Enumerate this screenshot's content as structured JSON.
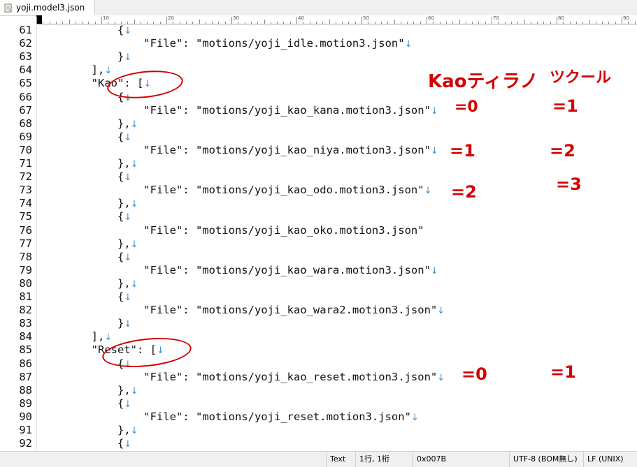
{
  "tab": {
    "title": "yoji.model3.json",
    "close_glyph": "⊠",
    "icon": "text-file-icon"
  },
  "ruler": {
    "labels": [
      "10",
      "20",
      "30",
      "40",
      "50",
      "60",
      "70",
      "80",
      "90"
    ]
  },
  "code_lines": [
    {
      "num": "61",
      "text": "            {",
      "eol": "↓"
    },
    {
      "num": "62",
      "text": "                \"File\": \"motions/yoji_idle.motion3.json\"",
      "eol": "↓"
    },
    {
      "num": "63",
      "text": "            }",
      "eol": "↓"
    },
    {
      "num": "64",
      "text": "        ],",
      "eol": "↓"
    },
    {
      "num": "65",
      "text": "        \"Kao\": [",
      "eol": "↓"
    },
    {
      "num": "66",
      "text": "            {",
      "eol": "↓"
    },
    {
      "num": "67",
      "text": "                \"File\": \"motions/yoji_kao_kana.motion3.json\"",
      "eol": "↓"
    },
    {
      "num": "68",
      "text": "            },",
      "eol": "↓"
    },
    {
      "num": "69",
      "text": "            {",
      "eol": "↓"
    },
    {
      "num": "70",
      "text": "                \"File\": \"motions/yoji_kao_niya.motion3.json\"",
      "eol": "↓"
    },
    {
      "num": "71",
      "text": "            },",
      "eol": "↓"
    },
    {
      "num": "72",
      "text": "            {",
      "eol": "↓"
    },
    {
      "num": "73",
      "text": "                \"File\": \"motions/yoji_kao_odo.motion3.json\"",
      "eol": "↓"
    },
    {
      "num": "74",
      "text": "            },",
      "eol": "↓"
    },
    {
      "num": "75",
      "text": "            {",
      "eol": "↓"
    },
    {
      "num": "76",
      "text": "                \"File\": \"motions/yoji_kao_oko.motion3.json\"",
      "eol": ""
    },
    {
      "num": "77",
      "text": "            },",
      "eol": "↓"
    },
    {
      "num": "78",
      "text": "            {",
      "eol": "↓"
    },
    {
      "num": "79",
      "text": "                \"File\": \"motions/yoji_kao_wara.motion3.json\"",
      "eol": "↓"
    },
    {
      "num": "80",
      "text": "            },",
      "eol": "↓"
    },
    {
      "num": "81",
      "text": "            {",
      "eol": "↓"
    },
    {
      "num": "82",
      "text": "                \"File\": \"motions/yoji_kao_wara2.motion3.json\"",
      "eol": "↓"
    },
    {
      "num": "83",
      "text": "            }",
      "eol": "↓"
    },
    {
      "num": "84",
      "text": "        ],",
      "eol": "↓"
    },
    {
      "num": "85",
      "text": "        \"Reset\": [",
      "eol": "↓"
    },
    {
      "num": "86",
      "text": "            {",
      "eol": "↓"
    },
    {
      "num": "87",
      "text": "                \"File\": \"motions/yoji_kao_reset.motion3.json\"",
      "eol": "↓"
    },
    {
      "num": "88",
      "text": "            },",
      "eol": "↓"
    },
    {
      "num": "89",
      "text": "            {",
      "eol": "↓"
    },
    {
      "num": "90",
      "text": "                \"File\": \"motions/yoji_reset.motion3.json\"",
      "eol": "↓"
    },
    {
      "num": "91",
      "text": "            },",
      "eol": "↓"
    },
    {
      "num": "92",
      "text": "            {",
      "eol": "↓"
    }
  ],
  "annotations": {
    "header_kao": "Kaoティラノ",
    "header_tsukuru": "ツクール",
    "kana_kao": "=0",
    "kana_tsukuru": "=1",
    "niya_kao": "=1",
    "niya_tsukuru": "=2",
    "odo_kao": "=2",
    "odo_tsukuru": "=3",
    "reset_kao": "=0",
    "reset_tsukuru": "=1",
    "color": "#d40000"
  },
  "status": {
    "mode": "Text",
    "position": "1行, 1桁",
    "char_code": "0x007B",
    "encoding": "UTF-8 (BOM無し)",
    "line_ending": "LF (UNIX)"
  }
}
